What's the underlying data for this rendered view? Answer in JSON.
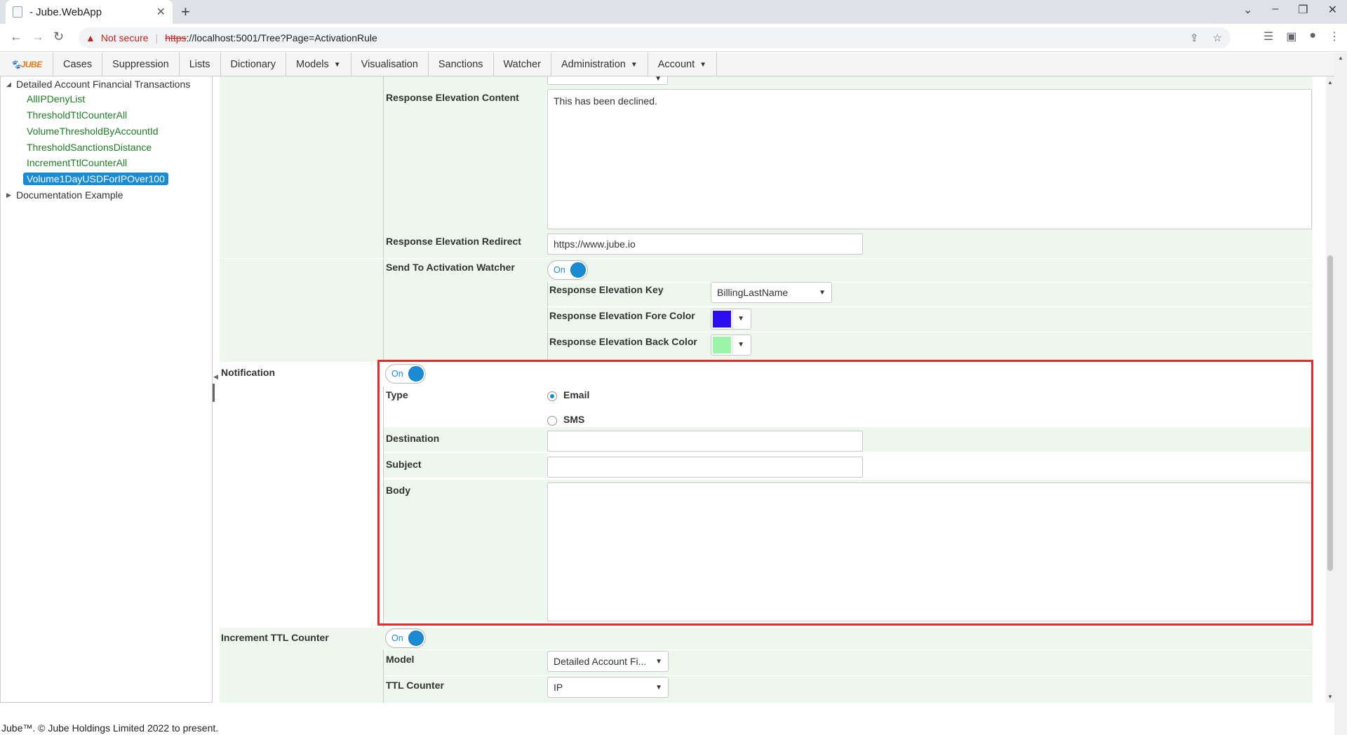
{
  "browser": {
    "tab_title": "- Jube.WebApp",
    "tab_close": "✕",
    "new_tab": "+",
    "not_secure": "Not secure",
    "url_scheme": "https",
    "url_rest": "://localhost:5001/Tree?Page=ActivationRule"
  },
  "nav": {
    "logo_main": "JUBE",
    "items": [
      "Cases",
      "Suppression",
      "Lists",
      "Dictionary",
      "Models",
      "Visualisation",
      "Sanctions",
      "Watcher",
      "Administration",
      "Account"
    ]
  },
  "tree": {
    "root_expanded": "Detailed Account Financial Transactions",
    "children": [
      "AllIPDenyList",
      "ThresholdTtlCounterAll",
      "VolumeThresholdByAccountId",
      "ThresholdSanctionsDistance",
      "IncrementTtlCounterAll",
      "Volume1DayUSDForIPOver100"
    ],
    "selected": "Volume1DayUSDForIPOver100",
    "root_collapsed": "Documentation Example"
  },
  "form": {
    "response_elevation_content": {
      "label": "Response Elevation Content",
      "value": "This has been declined."
    },
    "response_elevation_redirect": {
      "label": "Response Elevation Redirect",
      "value": "https://www.jube.io"
    },
    "send_to_activation_watcher": {
      "label": "Send To Activation Watcher",
      "toggle": "On",
      "key_label": "Response Elevation Key",
      "key_value": "BillingLastName",
      "fore_label": "Response Elevation Fore Color",
      "fore_color": "#2a0ef0",
      "back_label": "Response Elevation Back Color",
      "back_color": "#9cf5a8"
    },
    "notification": {
      "label": "Notification",
      "toggle": "On",
      "type_label": "Type",
      "type_options": [
        "Email",
        "SMS"
      ],
      "type_selected": "Email",
      "destination_label": "Destination",
      "destination_value": "",
      "subject_label": "Subject",
      "subject_value": "",
      "body_label": "Body",
      "body_value": ""
    },
    "increment_ttl_counter": {
      "label": "Increment TTL Counter",
      "toggle": "On",
      "model_label": "Model",
      "model_value": "Detailed Account Fi...",
      "ttl_label": "TTL Counter",
      "ttl_value": "IP"
    }
  },
  "footer": "Jube™. © Jube Holdings Limited 2022 to present.",
  "colors": {
    "accent": "#1a8bd5",
    "highlight_box": "#e32b2b",
    "row_green": "#eef7ee",
    "tree_link": "#1e7e23"
  }
}
